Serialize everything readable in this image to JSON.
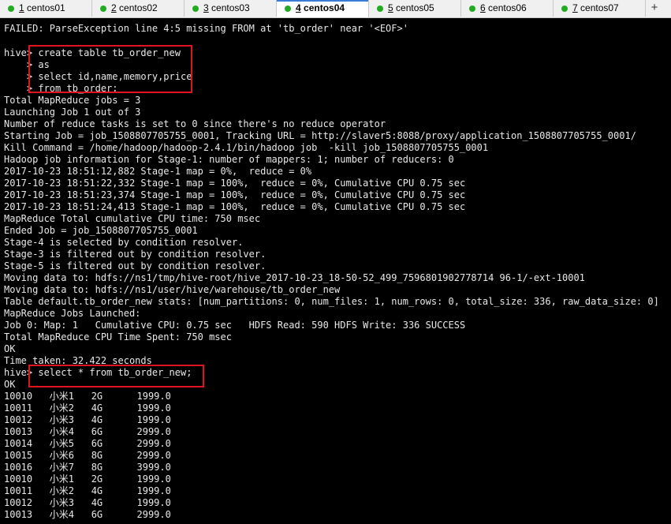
{
  "tabs": [
    {
      "number": "1",
      "name": "centos01"
    },
    {
      "number": "2",
      "name": "centos02"
    },
    {
      "number": "3",
      "name": "centos03"
    },
    {
      "number": "4",
      "name": "centos04"
    },
    {
      "number": "5",
      "name": "centos05"
    },
    {
      "number": "6",
      "name": "centos06"
    },
    {
      "number": "7",
      "name": "centos07"
    }
  ],
  "active_tab": "4 centos04",
  "new_tab_label": "+",
  "colors": {
    "status_dot": "#22aa22",
    "highlight_box": "#e0141e",
    "terminal_bg": "#000000",
    "terminal_fg": "#e8e8e8"
  },
  "icons": {
    "status": "status-dot-icon",
    "new_tab": "plus-icon"
  },
  "terminal_lines": [
    "FAILED: ParseException line 4:5 missing FROM at 'tb_order' near '<EOF>'",
    "",
    "hive> create table tb_order_new",
    "    > as",
    "    > select id,name,memory,price",
    "    > from tb_order;",
    "Total MapReduce jobs = 3",
    "Launching Job 1 out of 3",
    "Number of reduce tasks is set to 0 since there's no reduce operator",
    "Starting Job = job_1508807705755_0001, Tracking URL = http://slaver5:8088/proxy/application_1508807705755_0001/",
    "Kill Command = /home/hadoop/hadoop-2.4.1/bin/hadoop job  -kill job_1508807705755_0001",
    "Hadoop job information for Stage-1: number of mappers: 1; number of reducers: 0",
    "2017-10-23 18:51:12,882 Stage-1 map = 0%,  reduce = 0%",
    "2017-10-23 18:51:22,332 Stage-1 map = 100%,  reduce = 0%, Cumulative CPU 0.75 sec",
    "2017-10-23 18:51:23,374 Stage-1 map = 100%,  reduce = 0%, Cumulative CPU 0.75 sec",
    "2017-10-23 18:51:24,413 Stage-1 map = 100%,  reduce = 0%, Cumulative CPU 0.75 sec",
    "MapReduce Total cumulative CPU time: 750 msec",
    "Ended Job = job_1508807705755_0001",
    "Stage-4 is selected by condition resolver.",
    "Stage-3 is filtered out by condition resolver.",
    "Stage-5 is filtered out by condition resolver.",
    "Moving data to: hdfs://ns1/tmp/hive-root/hive_2017-10-23_18-50-52_499_7596801902778714 96-1/-ext-10001",
    "Moving data to: hdfs://ns1/user/hive/warehouse/tb_order_new",
    "Table default.tb_order_new stats: [num_partitions: 0, num_files: 1, num_rows: 0, total_size: 336, raw_data_size: 0]",
    "MapReduce Jobs Launched:",
    "Job 0: Map: 1   Cumulative CPU: 0.75 sec   HDFS Read: 590 HDFS Write: 336 SUCCESS",
    "Total MapReduce CPU Time Spent: 750 msec",
    "OK",
    "Time taken: 32.422 seconds",
    "hive> select * from tb_order_new;",
    "OK",
    "10010   小米1   2G      1999.0",
    "10011   小米2   4G      1999.0",
    "10012   小米3   4G      1999.0",
    "10013   小米4   6G      2999.0",
    "10014   小米5   6G      2999.0",
    "10015   小米6   8G      2999.0",
    "10016   小米7   8G      3999.0",
    "10010   小米1   2G      1999.0",
    "10011   小米2   4G      1999.0",
    "10012   小米3   4G      1999.0",
    "10013   小米4   6G      2999.0"
  ]
}
